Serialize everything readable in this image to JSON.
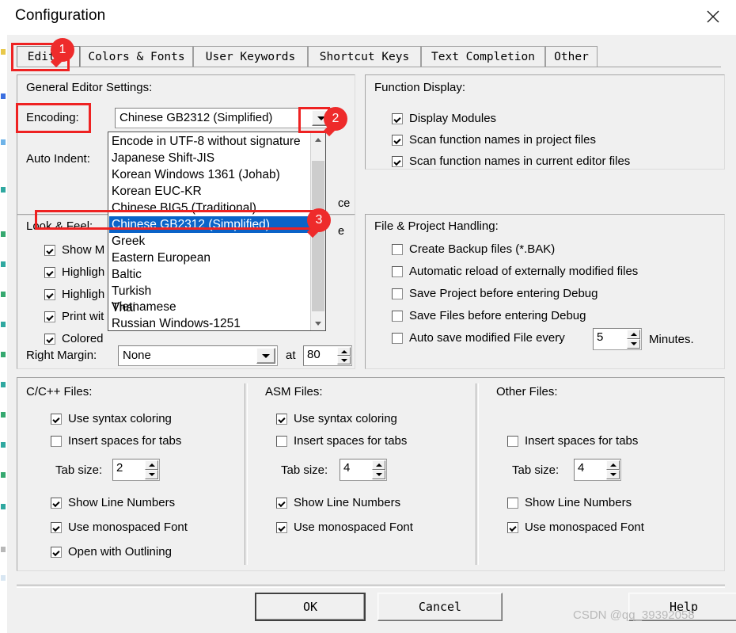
{
  "window": {
    "title": "Configuration",
    "close_icon": "close-icon"
  },
  "tabs": [
    {
      "label": "Editor",
      "selected": true
    },
    {
      "label": "Colors & Fonts",
      "selected": false
    },
    {
      "label": "User Keywords",
      "selected": false
    },
    {
      "label": "Shortcut Keys",
      "selected": false
    },
    {
      "label": "Text Completion",
      "selected": false
    },
    {
      "label": "Other",
      "selected": false
    }
  ],
  "general_editor": {
    "group_title": "General Editor Settings:",
    "encoding_label": "Encoding:",
    "encoding_value": "Chinese GB2312 (Simplified)",
    "auto_indent_label": "Auto Indent:",
    "auto_indent_partial_1": "ce",
    "auto_indent_partial_2": "e"
  },
  "encoding_dropdown": {
    "open": true,
    "items": [
      "Encode in UTF-8 without signature",
      "Japanese Shift-JIS",
      "Korean Windows 1361 (Johab)",
      "Korean EUC-KR",
      "Chinese BIG5 (Traditional)",
      "Chinese GB2312 (Simplified)",
      "Greek",
      "Eastern European",
      "Baltic",
      "Turkish",
      "Thai",
      "Vietnamese",
      "Russian Windows-1251"
    ],
    "selected_index": 5,
    "selected_color": "#0a63c8"
  },
  "function_display": {
    "group_title": "Function Display:",
    "items": [
      {
        "label": "Display Modules",
        "checked": true
      },
      {
        "label": "Scan function names in project files",
        "checked": true
      },
      {
        "label": "Scan function names in current editor files",
        "checked": true
      }
    ]
  },
  "look_and_feel": {
    "group_title": "Look & Feel:",
    "items": [
      {
        "label": "Show M",
        "checked": true
      },
      {
        "label": "Highligh",
        "checked": true
      },
      {
        "label": "Highligh",
        "checked": true
      },
      {
        "label": "Print wit",
        "checked": true
      },
      {
        "label": "Colored",
        "checked": true
      }
    ],
    "right_margin_label": "Right Margin:",
    "right_margin_value": "None",
    "at_label": "at",
    "at_value": "80"
  },
  "file_project_handling": {
    "group_title": "File & Project Handling:",
    "items": [
      {
        "label": "Create Backup files (*.BAK)",
        "checked": false
      },
      {
        "label": "Automatic reload of externally modified files",
        "checked": false
      },
      {
        "label": "Save Project before entering Debug",
        "checked": false
      },
      {
        "label": "Save Files before entering Debug",
        "checked": false
      },
      {
        "label": "Auto save modified File every",
        "checked": false
      }
    ],
    "auto_save_value": "5",
    "minutes_label": "Minutes."
  },
  "c_files": {
    "group_title": "C/C++ Files:",
    "use_syntax_coloring": {
      "label": "Use syntax coloring",
      "checked": true
    },
    "insert_spaces": {
      "label": "Insert spaces for tabs",
      "checked": false
    },
    "tab_size_label": "Tab size:",
    "tab_size_value": "2",
    "show_line_numbers": {
      "label": "Show Line Numbers",
      "checked": true
    },
    "use_monospaced": {
      "label": "Use monospaced Font",
      "checked": true
    },
    "open_outlining": {
      "label": "Open with Outlining",
      "checked": true
    }
  },
  "asm_files": {
    "group_title": "ASM Files:",
    "use_syntax_coloring": {
      "label": "Use syntax coloring",
      "checked": true
    },
    "insert_spaces": {
      "label": "Insert spaces for tabs",
      "checked": false
    },
    "tab_size_label": "Tab size:",
    "tab_size_value": "4",
    "show_line_numbers": {
      "label": "Show Line Numbers",
      "checked": true
    },
    "use_monospaced": {
      "label": "Use monospaced Font",
      "checked": true
    }
  },
  "other_files": {
    "group_title": "Other Files:",
    "insert_spaces": {
      "label": "Insert spaces for tabs",
      "checked": false
    },
    "tab_size_label": "Tab size:",
    "tab_size_value": "4",
    "show_line_numbers": {
      "label": "Show Line Numbers",
      "checked": false
    },
    "use_monospaced": {
      "label": "Use monospaced Font",
      "checked": true
    }
  },
  "buttons": {
    "ok": "OK",
    "cancel": "Cancel",
    "help": "Help"
  },
  "annotations": {
    "badge_color": "#ee2b2b",
    "badges": [
      "1",
      "2",
      "3"
    ]
  },
  "watermark": "CSDN @qq_39392058"
}
